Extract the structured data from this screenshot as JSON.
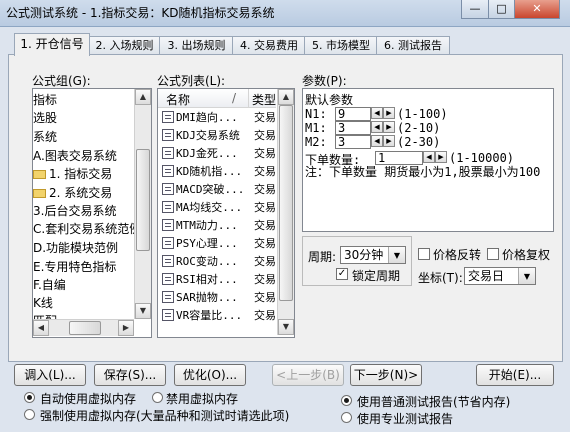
{
  "window": {
    "title": "公式测试系统 - 1.指标交易：KD随机指标交易系统",
    "minimize": "—",
    "maximize": "□",
    "close": "✕"
  },
  "tabs": [
    {
      "label": "1. 开仓信号"
    },
    {
      "label": "2. 入场规则"
    },
    {
      "label": "3. 出场规则"
    },
    {
      "label": "4. 交易费用"
    },
    {
      "label": "5. 市场模型"
    },
    {
      "label": "6. 测试报告"
    }
  ],
  "formula_group": {
    "label": "公式组(G):",
    "items": [
      "指标",
      "选股",
      "系统",
      "A.图表交易系统",
      "1. 指标交易",
      "2. 系统交易",
      "3.后台交易系统",
      "C.套利交易系统范例",
      "D.功能模块范例",
      "E.专用特色指标",
      "F.自编",
      "K线",
      "匹配"
    ]
  },
  "formula_list": {
    "label": "公式列表(L):",
    "col_name": "名称",
    "col_sep": "/",
    "col_type": "类型",
    "rows": [
      {
        "name": "DMI趋向...",
        "type": "交易"
      },
      {
        "name": "KDJ交易系统",
        "type": "交易"
      },
      {
        "name": "KDJ金死...",
        "type": "交易"
      },
      {
        "name": "KD随机指...",
        "type": "交易"
      },
      {
        "name": "MACD突破...",
        "type": "交易"
      },
      {
        "name": "MA均线交...",
        "type": "交易"
      },
      {
        "name": "MTM动力...",
        "type": "交易"
      },
      {
        "name": "PSY心理...",
        "type": "交易"
      },
      {
        "name": "ROC变动...",
        "type": "交易"
      },
      {
        "name": "RSI相对...",
        "type": "交易"
      },
      {
        "name": "SAR抛物...",
        "type": "交易"
      },
      {
        "name": "VR容量比...",
        "type": "交易"
      }
    ]
  },
  "params": {
    "label": "参数(P):",
    "default_title": "默认参数",
    "rows": [
      {
        "name": "N1:",
        "value": "9",
        "range": "(1-100)"
      },
      {
        "name": "M1:",
        "value": "3",
        "range": "(2-10)"
      },
      {
        "name": "M2:",
        "value": "3",
        "range": "(2-30)"
      }
    ],
    "order_label": "下单数量:",
    "order_value": "1",
    "order_range": "(1-10000)",
    "note": "注：下单数量 期货最小为1,股票最小为100"
  },
  "period": {
    "label": "周期:",
    "value": "30分钟",
    "lock_label": "锁定周期",
    "lock_checked": true
  },
  "price_reverse": {
    "label": "价格反转",
    "checked": false
  },
  "price_restore": {
    "label": "价格复权",
    "checked": false
  },
  "coord": {
    "label": "坐标(T):",
    "value": "交易日"
  },
  "buttons": {
    "import": "调入(L)...",
    "save": "保存(S)...",
    "optimize": "优化(O)...",
    "prev": "<上一步(B)",
    "next": "下一步(N)>",
    "start": "开始(E)..."
  },
  "memory": {
    "auto": "自动使用虚拟内存",
    "disable": "禁用虚拟内存",
    "force": "强制使用虚拟内存(大量品种和测试时请选此项)",
    "selected": "auto"
  },
  "report": {
    "normal": "使用普通测试报告(节省内存)",
    "pro": "使用专业测试报告",
    "selected": "normal"
  },
  "colors": {
    "window_bg": "#dde4ee",
    "panel_bg": "#f0f0f0",
    "list_bg": "#ffffff",
    "folder": "#f2d36b"
  }
}
